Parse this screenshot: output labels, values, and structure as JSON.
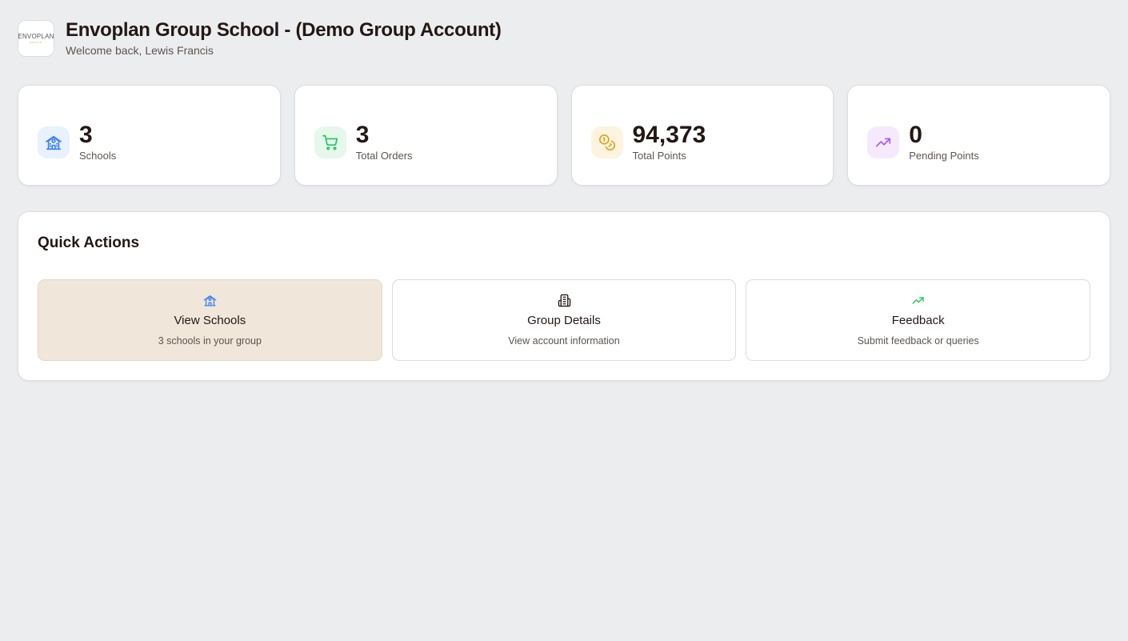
{
  "header": {
    "logo_text": "ENVOPLAN",
    "logo_subtext": "GROUP",
    "title": "Envoplan Group School - (Demo Group Account)",
    "subtitle": "Welcome back, Lewis Francis"
  },
  "stats": [
    {
      "value": "3",
      "label": "Schools",
      "icon": "school-icon",
      "color": "#3b82f6",
      "bg": "#e8f1fd"
    },
    {
      "value": "3",
      "label": "Total Orders",
      "icon": "cart-icon",
      "color": "#22c55e",
      "bg": "#e6f7ec"
    },
    {
      "value": "94,373",
      "label": "Total Points",
      "icon": "coins-icon",
      "color": "#e0a21a",
      "bg": "#fdf3df"
    },
    {
      "value": "0",
      "label": "Pending Points",
      "icon": "trending-up-icon",
      "color": "#a855f7",
      "bg": "#f5eafd"
    }
  ],
  "quick_actions": {
    "title": "Quick Actions",
    "items": [
      {
        "label": "View Schools",
        "description": "3 schools in your group",
        "icon": "school-icon",
        "color": "#3b82f6",
        "active": true
      },
      {
        "label": "Group Details",
        "description": "View account information",
        "icon": "building-icon",
        "color": "#231815",
        "active": false
      },
      {
        "label": "Feedback",
        "description": "Submit feedback or queries",
        "icon": "trending-up-icon",
        "color": "#22c55e",
        "active": false
      }
    ]
  }
}
